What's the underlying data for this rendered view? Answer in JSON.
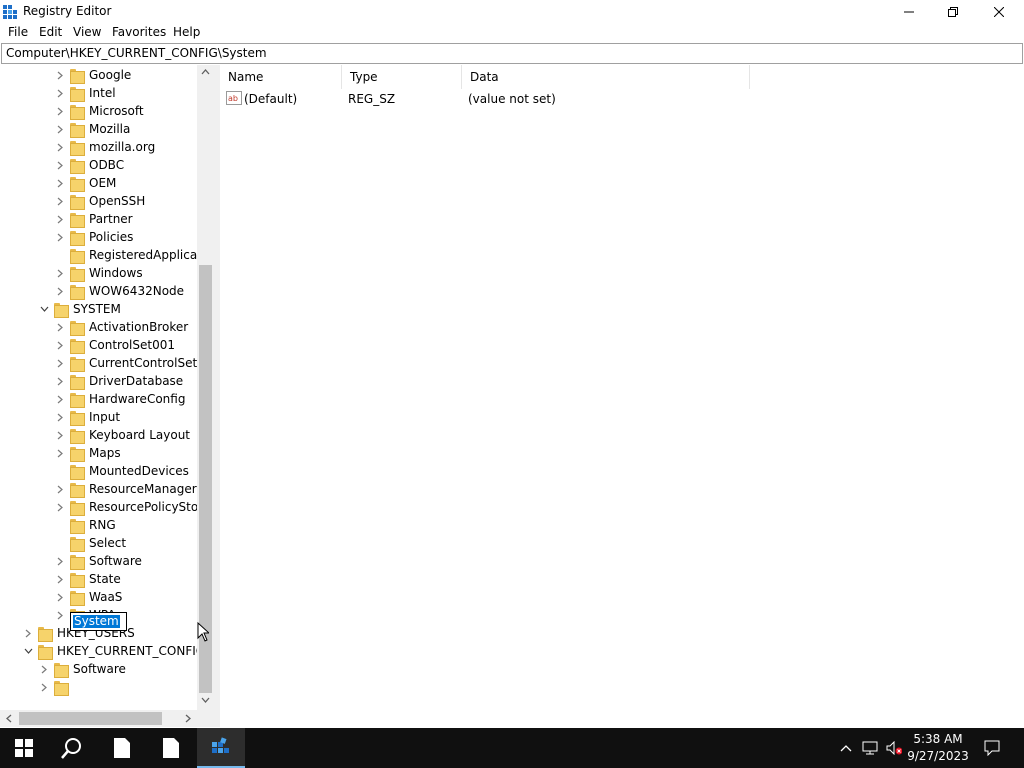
{
  "window": {
    "title": "Registry Editor"
  },
  "menu": [
    "File",
    "Edit",
    "View",
    "Favorites",
    "Help"
  ],
  "address_bar": {
    "path": "Computer\\HKEY_CURRENT_CONFIG\\System"
  },
  "tree": [
    {
      "label": "Google",
      "depth": 2,
      "expander": "collapsed"
    },
    {
      "label": "Intel",
      "depth": 2,
      "expander": "collapsed"
    },
    {
      "label": "Microsoft",
      "depth": 2,
      "expander": "collapsed"
    },
    {
      "label": "Mozilla",
      "depth": 2,
      "expander": "collapsed"
    },
    {
      "label": "mozilla.org",
      "depth": 2,
      "expander": "collapsed"
    },
    {
      "label": "ODBC",
      "depth": 2,
      "expander": "collapsed"
    },
    {
      "label": "OEM",
      "depth": 2,
      "expander": "collapsed"
    },
    {
      "label": "OpenSSH",
      "depth": 2,
      "expander": "collapsed"
    },
    {
      "label": "Partner",
      "depth": 2,
      "expander": "collapsed"
    },
    {
      "label": "Policies",
      "depth": 2,
      "expander": "collapsed"
    },
    {
      "label": "RegisteredApplicatic",
      "depth": 2,
      "expander": "none"
    },
    {
      "label": "Windows",
      "depth": 2,
      "expander": "collapsed"
    },
    {
      "label": "WOW6432Node",
      "depth": 2,
      "expander": "collapsed"
    },
    {
      "label": "SYSTEM",
      "depth": 1,
      "expander": "expanded"
    },
    {
      "label": "ActivationBroker",
      "depth": 2,
      "expander": "collapsed"
    },
    {
      "label": "ControlSet001",
      "depth": 2,
      "expander": "collapsed"
    },
    {
      "label": "CurrentControlSet",
      "depth": 2,
      "expander": "collapsed"
    },
    {
      "label": "DriverDatabase",
      "depth": 2,
      "expander": "collapsed"
    },
    {
      "label": "HardwareConfig",
      "depth": 2,
      "expander": "collapsed"
    },
    {
      "label": "Input",
      "depth": 2,
      "expander": "collapsed"
    },
    {
      "label": "Keyboard Layout",
      "depth": 2,
      "expander": "collapsed"
    },
    {
      "label": "Maps",
      "depth": 2,
      "expander": "collapsed"
    },
    {
      "label": "MountedDevices",
      "depth": 2,
      "expander": "none"
    },
    {
      "label": "ResourceManager",
      "depth": 2,
      "expander": "collapsed"
    },
    {
      "label": "ResourcePolicyStore",
      "depth": 2,
      "expander": "collapsed"
    },
    {
      "label": "RNG",
      "depth": 2,
      "expander": "none"
    },
    {
      "label": "Select",
      "depth": 2,
      "expander": "none"
    },
    {
      "label": "Software",
      "depth": 2,
      "expander": "collapsed"
    },
    {
      "label": "State",
      "depth": 2,
      "expander": "collapsed"
    },
    {
      "label": "WaaS",
      "depth": 2,
      "expander": "collapsed"
    },
    {
      "label": "WPA",
      "depth": 2,
      "expander": "collapsed"
    },
    {
      "label": "HKEY_USERS",
      "depth": 0,
      "expander": "collapsed"
    },
    {
      "label": "HKEY_CURRENT_CONFIG",
      "depth": 0,
      "expander": "expanded"
    },
    {
      "label": "Software",
      "depth": 1,
      "expander": "collapsed"
    },
    {
      "label": "",
      "depth": 1,
      "expander": "collapsed"
    }
  ],
  "rename_edit": {
    "value": "System"
  },
  "list": {
    "columns": [
      "Name",
      "Type",
      "Data"
    ],
    "rows": [
      {
        "name": "(Default)",
        "type": "REG_SZ",
        "data": "(value not set)",
        "icon": "string-value-icon"
      }
    ]
  },
  "taskbar": {
    "clock": {
      "time": "5:38 AM",
      "date": "9/27/2023"
    }
  }
}
